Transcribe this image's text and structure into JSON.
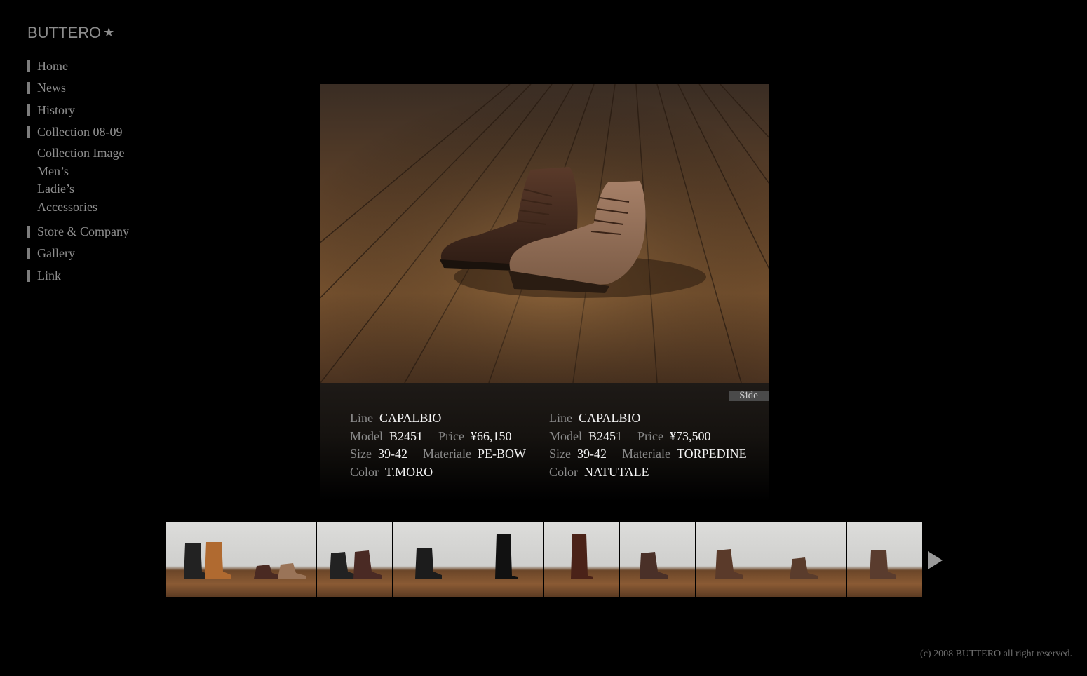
{
  "logo": {
    "text": "BUTTERO",
    "star": "★"
  },
  "nav": {
    "items": [
      {
        "label": "Home"
      },
      {
        "label": "News"
      },
      {
        "label": "History"
      },
      {
        "label": "Collection 08-09"
      }
    ],
    "sub_items": [
      {
        "label": "Collection Image"
      },
      {
        "label": "Men’s"
      },
      {
        "label": "Ladie’s"
      },
      {
        "label": "Accessories"
      }
    ],
    "items_after": [
      {
        "label": "Store & Company"
      },
      {
        "label": "Gallery"
      },
      {
        "label": "Link"
      }
    ]
  },
  "hero": {
    "side_tab": "Side"
  },
  "products": [
    {
      "line_label": "Line",
      "line": "CAPALBIO",
      "model_label": "Model",
      "model": "B2451",
      "price_label": "Price",
      "price": "¥66,150",
      "size_label": "Size",
      "size": "39-42",
      "materiale_label": "Materiale",
      "materiale": "PE-BOW",
      "color_label": "Color",
      "color": "T.MORO"
    },
    {
      "line_label": "Line",
      "line": "CAPALBIO",
      "model_label": "Model",
      "model": "B2451",
      "price_label": "Price",
      "price": "¥73,500",
      "size_label": "Size",
      "size": "39-42",
      "materiale_label": "Materiale",
      "materiale": "TORPEDINE",
      "color_label": "Color",
      "color": "NATUTALE"
    }
  ],
  "thumbnails": [
    {
      "name": "thumb-engineer-boots-black-tan"
    },
    {
      "name": "thumb-low-boots-brown-beige"
    },
    {
      "name": "thumb-lace-boots-black-brown"
    },
    {
      "name": "thumb-buckle-boots-black"
    },
    {
      "name": "thumb-tall-boot-black"
    },
    {
      "name": "thumb-tall-boot-brown"
    },
    {
      "name": "thumb-side-gore-boot-brown"
    },
    {
      "name": "thumb-lace-up-boot-brown"
    },
    {
      "name": "thumb-chukka-brown"
    },
    {
      "name": "thumb-buckle-ankle-boot-brown"
    }
  ],
  "next_icon": "play-arrow-icon",
  "footer": {
    "copyright": "(c)  2008 BUTTERO all right reserved."
  }
}
